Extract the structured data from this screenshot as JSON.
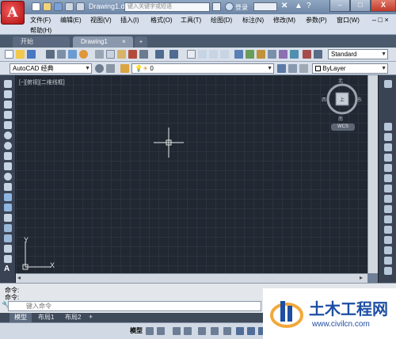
{
  "title_bar": {
    "doc_title": "Drawing1.dwg",
    "search_placeholder": "键入关键字或短语",
    "login_label": "登录",
    "window_buttons": [
      "–",
      "□",
      "X"
    ],
    "app_icon": "autocad-logo-A"
  },
  "menus": [
    "文件(F)",
    "编辑(E)",
    "视图(V)",
    "插入(I)",
    "格式(O)",
    "工具(T)",
    "绘图(D)",
    "标注(N)",
    "修改(M)",
    "参数(P)",
    "窗口(W)",
    "帮助(H)"
  ],
  "doc_tabs": [
    "开始",
    "Drawing1"
  ],
  "new_tab_glyph": "+",
  "toolbars": {
    "text_style": "Standard",
    "workspace": "AutoCAD 经典",
    "layer": "0",
    "color": "ByLayer"
  },
  "viewport": {
    "label": "[−][俯视][二维线框]",
    "viewcube": {
      "north": "北",
      "south": "南",
      "east": "东",
      "west": "西",
      "top_face": "上",
      "wcs": "WCS"
    },
    "ucs_x": "X",
    "ucs_y": "Y"
  },
  "command": {
    "history": [
      "命令:",
      "命令:"
    ],
    "input_placeholder": "键入命令"
  },
  "layout_tabs": [
    "模型",
    "布局1",
    "布局2"
  ],
  "status": {
    "model_label": "模型"
  },
  "watermark": {
    "brand": "土木工程网",
    "url": "www.civilcn.com"
  },
  "colors": {
    "canvas": "#212832",
    "accent": "#1d4ea3"
  }
}
